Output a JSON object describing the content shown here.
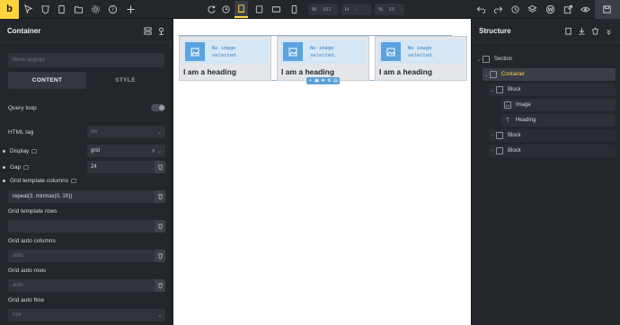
{
  "topbar": {
    "logo": "b",
    "left_icons": [
      "pointer-icon",
      "shield-icon",
      "page-icon",
      "folder-icon",
      "gear-icon",
      "help-icon",
      "plus-icon"
    ],
    "center_icons": [
      "refresh-icon",
      "undo-history-icon",
      "desktop-breakpoint-icon",
      "tablet-landscape-icon",
      "laptop-icon",
      "mobile-icon"
    ],
    "width_prefix": "W",
    "width_value": "992",
    "height_prefix": "H",
    "height_value": "-",
    "zoom_prefix": "%",
    "zoom_value": "68",
    "right_icons": [
      "undo-icon",
      "redo-icon",
      "history-icon",
      "layers-icon",
      "wordpress-icon",
      "external-link-icon",
      "eye-icon",
      "save-icon"
    ]
  },
  "left_panel": {
    "title": "Container",
    "id_placeholder": "#brxe-spgoqo",
    "tabs": [
      "CONTENT",
      "STYLE"
    ],
    "query_loop_label": "Query loop",
    "html_tag_label": "HTML tag",
    "html_tag_placeholder": "div",
    "display_label": "Display",
    "display_value": "grid",
    "gap_label": "Gap",
    "gap_value": "24",
    "gtc_label": "Grid template columns",
    "gtc_value": "repeat(3, minmax(0, 1fr))",
    "gtr_label": "Grid template rows",
    "gtr_value": "",
    "gac_label": "Grid auto columns",
    "gac_placeholder": "auto",
    "gar_label": "Grid auto rows",
    "gar_placeholder": "auto",
    "gaf_label": "Grid auto flow",
    "gaf_placeholder": "row"
  },
  "canvas": {
    "cards": [
      {
        "image_text_1": "No image",
        "image_text_2": "selected.",
        "heading": "I am a heading"
      },
      {
        "image_text_1": "No image",
        "image_text_2": "selected.",
        "heading": "I am a heading"
      },
      {
        "image_text_1": "No image",
        "image_text_2": "selected.",
        "heading": "I am a heading"
      }
    ]
  },
  "structure": {
    "title": "Structure",
    "items": [
      {
        "label": "Section"
      },
      {
        "label": "Container"
      },
      {
        "label": "Block"
      },
      {
        "label": "Image"
      },
      {
        "label": "Heading"
      },
      {
        "label": "Block"
      },
      {
        "label": "Block"
      }
    ]
  },
  "colors": {
    "accent": "#ffd53d",
    "panel_bg": "#23262b",
    "selection_blue": "#5a9fd8"
  }
}
